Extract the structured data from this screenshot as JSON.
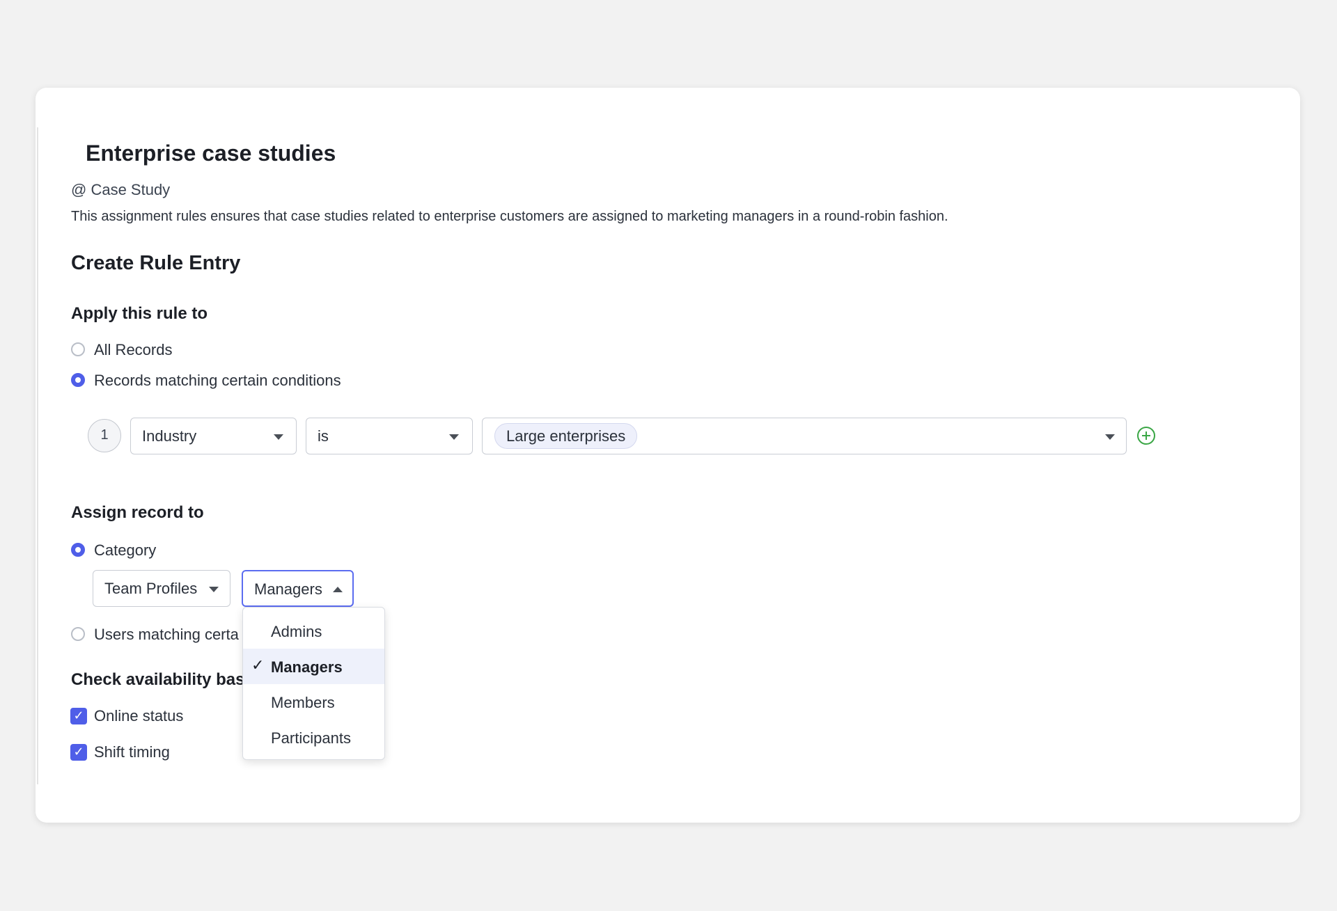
{
  "rule": {
    "title": "Enterprise case studies",
    "module": "@ Case Study",
    "description": "This assignment rules ensures that case studies related to enterprise customers are assigned to marketing managers in a round-robin fashion."
  },
  "section_title": "Create Rule Entry",
  "apply": {
    "heading": "Apply this rule to",
    "options": [
      {
        "label": "All Records",
        "selected": false
      },
      {
        "label": "Records matching certain conditions",
        "selected": true
      }
    ],
    "condition": {
      "index": "1",
      "field": "Industry",
      "operator": "is",
      "value_tag": "Large enterprises"
    }
  },
  "assign": {
    "heading": "Assign record to",
    "category_label": "Category",
    "category_selected": true,
    "category_select": "Team Profiles",
    "role_select": "Managers",
    "users_label_visible": "Users matching certa",
    "dropdown_options": [
      {
        "label": "Admins",
        "selected": false
      },
      {
        "label": "Managers",
        "selected": true
      },
      {
        "label": "Members",
        "selected": false
      },
      {
        "label": "Participants",
        "selected": false
      }
    ]
  },
  "availability": {
    "heading_visible": "Check availability bas",
    "checks": [
      {
        "label": "Online status",
        "checked": true
      },
      {
        "label": "Shift timing",
        "checked": true
      }
    ]
  },
  "colors": {
    "accent": "#4f5ee8",
    "add_icon": "#3aa645"
  },
  "icons": {
    "add": "plus-circle-icon",
    "check": "checkmark-icon"
  }
}
